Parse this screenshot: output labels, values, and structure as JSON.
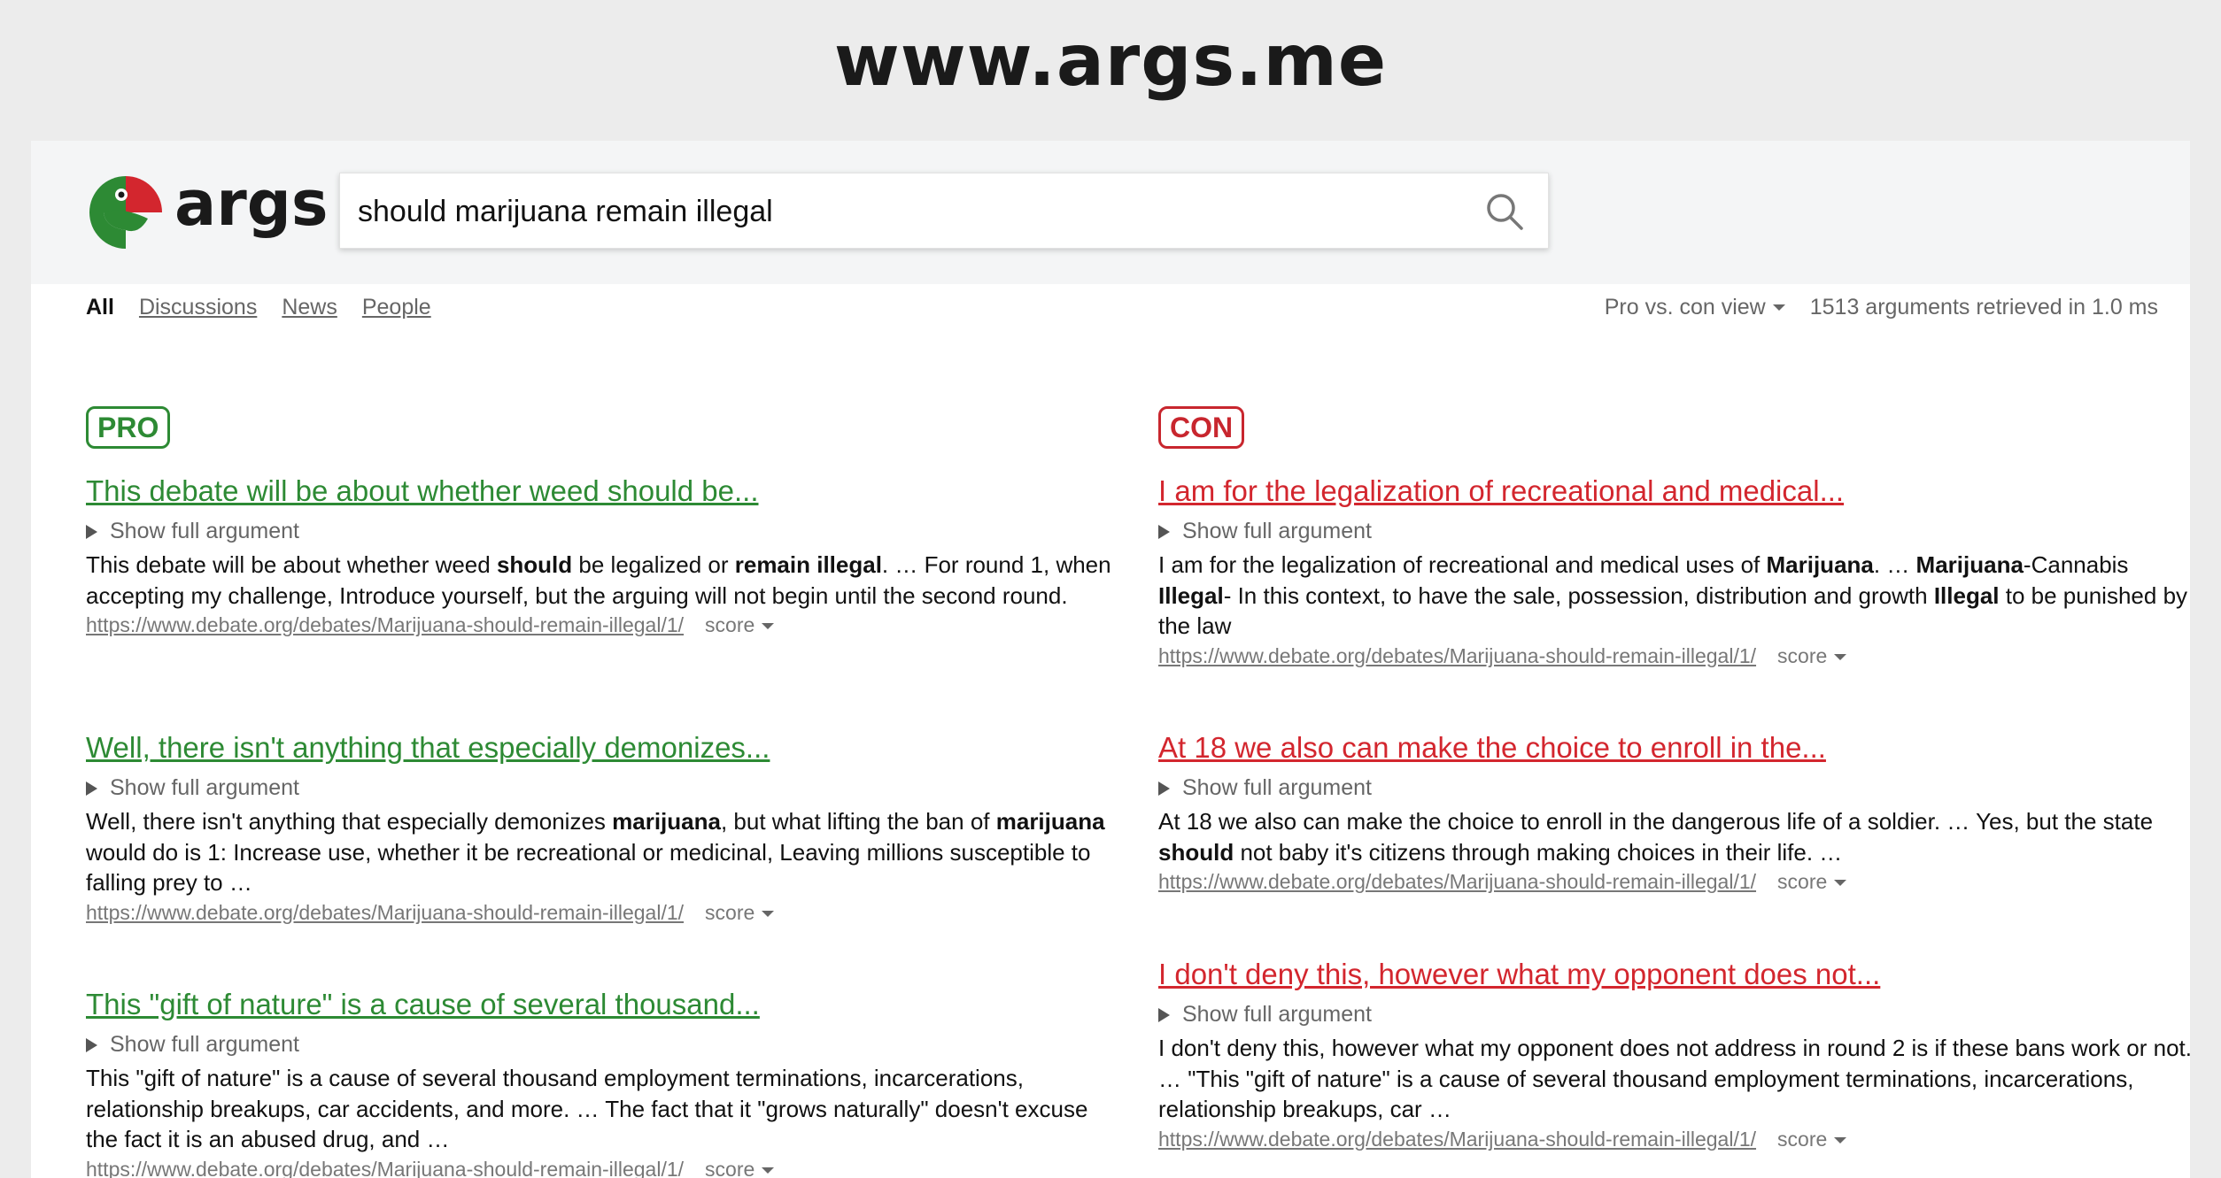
{
  "site_title": "www.args.me",
  "header": {
    "logo_text": "args",
    "search": {
      "value": "should marijuana remain illegal",
      "icon": "search-icon"
    }
  },
  "nav": {
    "tabs": [
      {
        "label": "All",
        "active": true
      },
      {
        "label": "Discussions",
        "active": false
      },
      {
        "label": "News",
        "active": false
      },
      {
        "label": "People",
        "active": false
      }
    ]
  },
  "toolbar": {
    "view_label": "Pro vs. con view",
    "stats": "1513 arguments retrieved in 1.0 ms"
  },
  "pro": {
    "label": "PRO",
    "results": [
      {
        "title": "This debate will be about whether weed should be...",
        "show_full": "Show full argument",
        "snippet": [
          {
            "t": "This debate will be about whether weed "
          },
          {
            "t": "should",
            "b": true
          },
          {
            "t": " be legalized or "
          },
          {
            "t": "remain illegal",
            "b": true
          },
          {
            "t": ". … For round 1, when accepting my challenge, Introduce yourself, but the arguing will not begin until the second round."
          }
        ],
        "url": "https://www.debate.org/debates/Marijuana-should-remain-illegal/1/",
        "score_label": "score"
      },
      {
        "title": "Well, there isn't anything that especially demonizes...",
        "show_full": "Show full argument",
        "snippet": [
          {
            "t": "Well, there isn't anything that especially demonizes "
          },
          {
            "t": "marijuana",
            "b": true
          },
          {
            "t": ", but what lifting the ban of "
          },
          {
            "t": "marijuana",
            "b": true
          },
          {
            "t": " would do is 1: Increase use, whether it be recreational or medicinal, Leaving millions susceptible to falling prey to …"
          }
        ],
        "url": "https://www.debate.org/debates/Marijuana-should-remain-illegal/1/",
        "score_label": "score"
      },
      {
        "title": "This \"gift of nature\" is a cause of several thousand...",
        "show_full": "Show full argument",
        "snippet": [
          {
            "t": "This \"gift of nature\" is a cause of several thousand employment terminations, incarcerations, relationship breakups, car accidents, and more. … The fact that it \"grows naturally\" doesn't excuse the fact it is an abused drug, and …"
          }
        ],
        "url": "https://www.debate.org/debates/Marijuana-should-remain-illegal/1/",
        "score_label": "score"
      }
    ]
  },
  "con": {
    "label": "CON",
    "results": [
      {
        "title": "I am for the legalization of recreational and medical...",
        "show_full": "Show full argument",
        "snippet": [
          {
            "t": "I am for the legalization of recreational and medical uses of "
          },
          {
            "t": "Marijuana",
            "b": true
          },
          {
            "t": ". … "
          },
          {
            "t": "Marijuana",
            "b": true
          },
          {
            "t": "-Cannabis "
          },
          {
            "t": "Illegal",
            "b": true
          },
          {
            "t": "- In this context, to have the sale, possession, distribution and growth "
          },
          {
            "t": "Illegal",
            "b": true
          },
          {
            "t": " to be punished by the law"
          }
        ],
        "url": "https://www.debate.org/debates/Marijuana-should-remain-illegal/1/",
        "score_label": "score"
      },
      {
        "title": "At 18 we also can make the choice to enroll in the...",
        "show_full": "Show full argument",
        "snippet": [
          {
            "t": "At 18 we also can make the choice to enroll in the dangerous life of a soldier. … Yes, but the state "
          },
          {
            "t": "should",
            "b": true
          },
          {
            "t": " not baby it's citizens through making choices in their life. …"
          }
        ],
        "url": "https://www.debate.org/debates/Marijuana-should-remain-illegal/1/",
        "score_label": "score"
      },
      {
        "title": "I don't deny this, however what my opponent does not...",
        "show_full": "Show full argument",
        "snippet": [
          {
            "t": "I don't deny this, however what my opponent does not address in round 2 is if these bans work or not. … \"This \"gift of nature\" is a cause of several thousand employment terminations, incarcerations, relationship breakups, car …"
          }
        ],
        "url": "https://www.debate.org/debates/Marijuana-should-remain-illegal/1/",
        "score_label": "score"
      }
    ]
  },
  "colors": {
    "pro": "#2d8a34",
    "con": "#d3262e"
  }
}
